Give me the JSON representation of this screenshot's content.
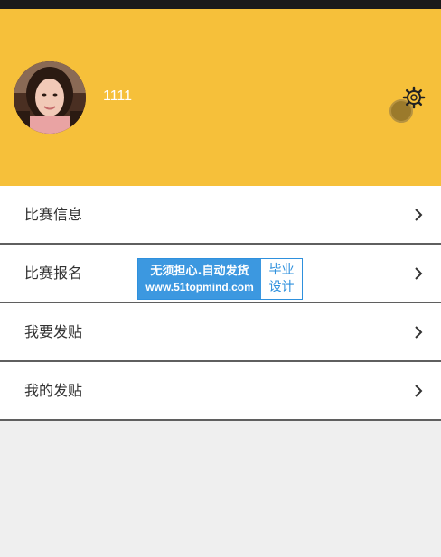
{
  "profile": {
    "username": "1111"
  },
  "icons": {
    "avatar": "avatar-photo",
    "settings": "gear-icon",
    "chevron": "chevron-right-icon"
  },
  "colors": {
    "header_bg": "#f6c03a",
    "page_bg": "#efefef",
    "divider": "#5f5f5f",
    "watermark_blue": "#3c98e0"
  },
  "menu": {
    "items": [
      {
        "label": "比赛信息"
      },
      {
        "label": "比赛报名"
      },
      {
        "label": "我要发贴"
      },
      {
        "label": "我的发贴"
      }
    ]
  },
  "watermark": {
    "line1": "无须担心.自动发货",
    "line2": "www.51topmind.com",
    "right_top": "毕业",
    "right_bottom": "设计"
  }
}
